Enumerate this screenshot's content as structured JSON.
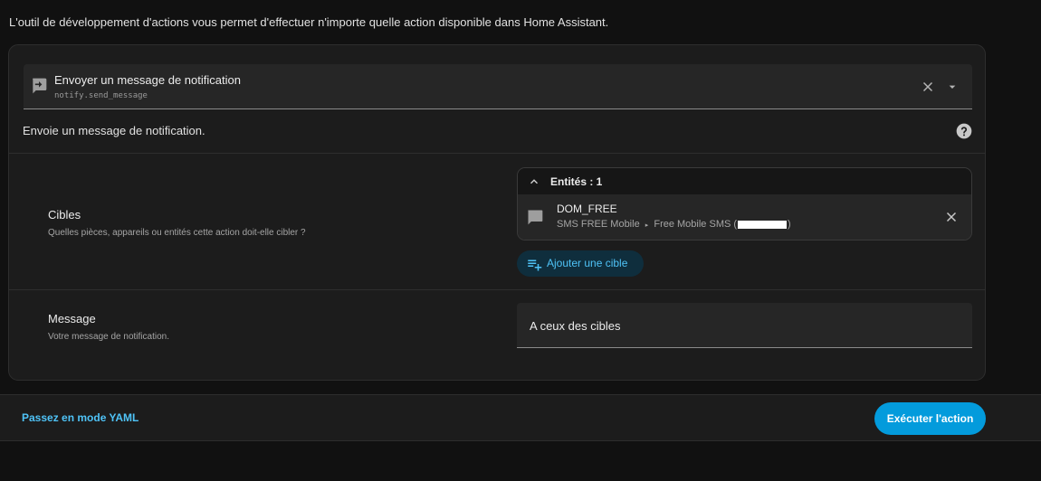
{
  "intro": "L'outil de développement d'actions vous permet d'effectuer n'importe quelle action disponible dans Home Assistant.",
  "action_picker": {
    "title": "Envoyer un message de notification",
    "service": "notify.send_message",
    "lead_icon": "notification-arrow-icon",
    "clear_icon": "close-icon",
    "dropdown_icon": "caret-down-icon"
  },
  "description": "Envoie un message de notification.",
  "fields": {
    "targets": {
      "title": "Cibles",
      "description": "Quelles pièces, appareils ou entités cette action doit-elle cibler ?",
      "header": "Entités : 1",
      "entities": [
        {
          "name": "DOM_FREE",
          "device": "SMS FREE Mobile",
          "integration": "Free Mobile SMS (",
          "suffix": ")"
        }
      ],
      "add_label": "Ajouter une cible"
    },
    "message": {
      "title": "Message",
      "description": "Votre message de notification.",
      "value": "A ceux des cibles"
    }
  },
  "footer": {
    "yaml_label": "Passez en mode YAML",
    "run_label": "Exécuter l'action"
  },
  "colors": {
    "accent": "#4fc3f7",
    "primary_button": "#039bdc",
    "background": "#111111",
    "card": "#1c1c1c"
  }
}
